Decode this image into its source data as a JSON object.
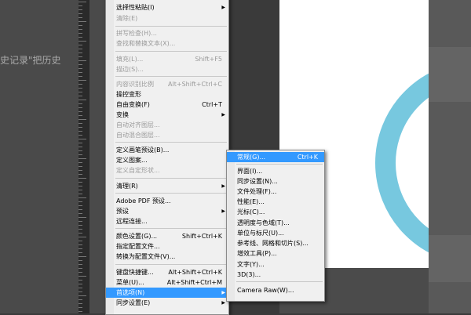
{
  "background": {
    "left_text": "史记录\"把历史"
  },
  "edit_menu": {
    "items": [
      {
        "label": "选择性粘贴(I)",
        "shortcut": "",
        "disabled": false
      },
      {
        "label": "清除(E)",
        "shortcut": "",
        "disabled": true
      },
      {
        "label": "拼写检查(H)...",
        "shortcut": "",
        "disabled": true
      },
      {
        "label": "查找和替换文本(X)...",
        "shortcut": "",
        "disabled": true
      },
      {
        "label": "填充(L)...",
        "shortcut": "Shift+F5",
        "disabled": true
      },
      {
        "label": "描边(S)...",
        "shortcut": "",
        "disabled": true
      },
      {
        "label": "内容识别比例",
        "shortcut": "Alt+Shift+Ctrl+C",
        "disabled": true
      },
      {
        "label": "操控变形",
        "shortcut": "",
        "disabled": false
      },
      {
        "label": "自由变换(F)",
        "shortcut": "Ctrl+T",
        "disabled": false
      },
      {
        "label": "变换",
        "shortcut": "",
        "disabled": false,
        "submenu": true
      },
      {
        "label": "自动对齐图层...",
        "shortcut": "",
        "disabled": true
      },
      {
        "label": "自动混合图层...",
        "shortcut": "",
        "disabled": true
      },
      {
        "label": "定义画笔预设(B)...",
        "shortcut": "",
        "disabled": false
      },
      {
        "label": "定义图案...",
        "shortcut": "",
        "disabled": false
      },
      {
        "label": "定义自定形状...",
        "shortcut": "",
        "disabled": true
      },
      {
        "label": "清理(R)",
        "shortcut": "",
        "disabled": false,
        "submenu": true
      },
      {
        "label": "Adobe PDF 预设...",
        "shortcut": "",
        "disabled": false
      },
      {
        "label": "预设",
        "shortcut": "",
        "disabled": false,
        "submenu": true
      },
      {
        "label": "远程连接...",
        "shortcut": "",
        "disabled": false
      },
      {
        "label": "颜色设置(G)...",
        "shortcut": "Shift+Ctrl+K",
        "disabled": false
      },
      {
        "label": "指定配置文件...",
        "shortcut": "",
        "disabled": false
      },
      {
        "label": "转换为配置文件(V)...",
        "shortcut": "",
        "disabled": false
      },
      {
        "label": "键盘快捷键...",
        "shortcut": "Alt+Shift+Ctrl+K",
        "disabled": false
      },
      {
        "label": "菜单(U)...",
        "shortcut": "Alt+Shift+Ctrl+M",
        "disabled": false
      },
      {
        "label": "首选项(N)",
        "shortcut": "",
        "disabled": false,
        "submenu": true,
        "highlight": true
      },
      {
        "label": "同步设置(E)",
        "shortcut": "",
        "disabled": false,
        "submenu": true
      }
    ]
  },
  "pref_menu": {
    "items": [
      {
        "label": "常规(G)...",
        "shortcut": "Ctrl+K",
        "highlight": true
      },
      {
        "label": "界面(I)...",
        "shortcut": ""
      },
      {
        "label": "同步设置(N)...",
        "shortcut": ""
      },
      {
        "label": "文件处理(F)...",
        "shortcut": ""
      },
      {
        "label": "性能(E)...",
        "shortcut": ""
      },
      {
        "label": "光标(C)...",
        "shortcut": ""
      },
      {
        "label": "透明度与色域(T)...",
        "shortcut": ""
      },
      {
        "label": "单位与标尺(U)...",
        "shortcut": ""
      },
      {
        "label": "参考线、网格和切片(S)...",
        "shortcut": ""
      },
      {
        "label": "增效工具(P)...",
        "shortcut": ""
      },
      {
        "label": "文字(Y)...",
        "shortcut": ""
      },
      {
        "label": "3D(3)...",
        "shortcut": ""
      },
      {
        "label": "Camera Raw(W)...",
        "shortcut": ""
      }
    ]
  },
  "colors": {
    "ring": "#77c8df",
    "highlight": "#3399ff"
  }
}
